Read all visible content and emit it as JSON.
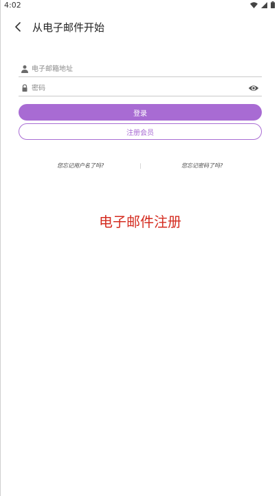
{
  "status_bar": {
    "time": "4:02"
  },
  "header": {
    "title": "从电子邮件开始"
  },
  "form": {
    "email_placeholder": "电子邮箱地址",
    "password_placeholder": "密码",
    "login_label": "登录",
    "register_label": "注册会员"
  },
  "links": {
    "forgot_username": "您忘记用户名了吗?",
    "forgot_password": "您忘记密码了吗?"
  },
  "banner": {
    "title": "电子邮件注册"
  },
  "colors": {
    "accent": "#a86bd3",
    "banner_red": "#d42b1f"
  }
}
